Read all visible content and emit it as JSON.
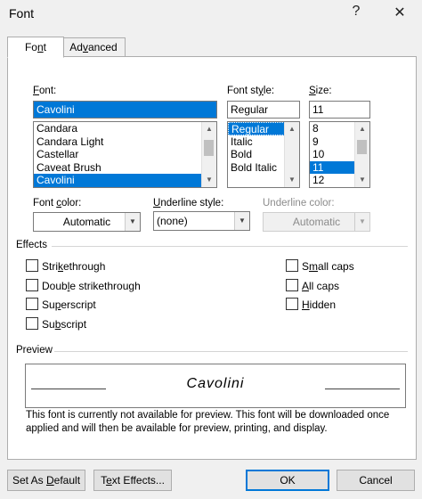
{
  "window": {
    "title": "Font",
    "help": "?",
    "close": "✕"
  },
  "tabs": [
    {
      "label": "Font",
      "mnemonic": "n"
    },
    {
      "label": "Advanced",
      "mnemonic": "v"
    }
  ],
  "font": {
    "label": "Font:",
    "value": "Cavolini",
    "items": [
      "Candara",
      "Candara Light",
      "Castellar",
      "Caveat Brush",
      "Cavolini"
    ],
    "selected": "Cavolini"
  },
  "font_style": {
    "label": "Font style:",
    "value": "Regular",
    "items": [
      "Regular",
      "Italic",
      "Bold",
      "Bold Italic"
    ],
    "selected": "Regular"
  },
  "size": {
    "label": "Size:",
    "value": "11",
    "items": [
      "8",
      "9",
      "10",
      "11",
      "12"
    ],
    "selected": "11"
  },
  "font_color": {
    "label": "Font color:",
    "value": "Automatic"
  },
  "underline_style": {
    "label": "Underline style:",
    "value": "(none)"
  },
  "underline_color": {
    "label": "Underline color:",
    "value": "Automatic"
  },
  "effects": {
    "label": "Effects",
    "left": [
      {
        "label": "Strikethrough",
        "checked": false
      },
      {
        "label": "Double strikethrough",
        "checked": false
      },
      {
        "label": "Superscript",
        "checked": false
      },
      {
        "label": "Subscript",
        "checked": false
      }
    ],
    "right": [
      {
        "label": "Small caps",
        "checked": false
      },
      {
        "label": "All caps",
        "checked": false
      },
      {
        "label": "Hidden",
        "checked": false
      }
    ]
  },
  "preview": {
    "label": "Preview",
    "sample": "Cavolini",
    "note": "This font is currently not available for preview. This font will be downloaded once applied and will then be available for preview, printing, and display."
  },
  "buttons": {
    "set_default": "Set As Default",
    "text_effects": "Text Effects...",
    "ok": "OK",
    "cancel": "Cancel"
  },
  "colors": {
    "selection": "#0078d7",
    "dialog_bg": "#f0f0f0"
  }
}
